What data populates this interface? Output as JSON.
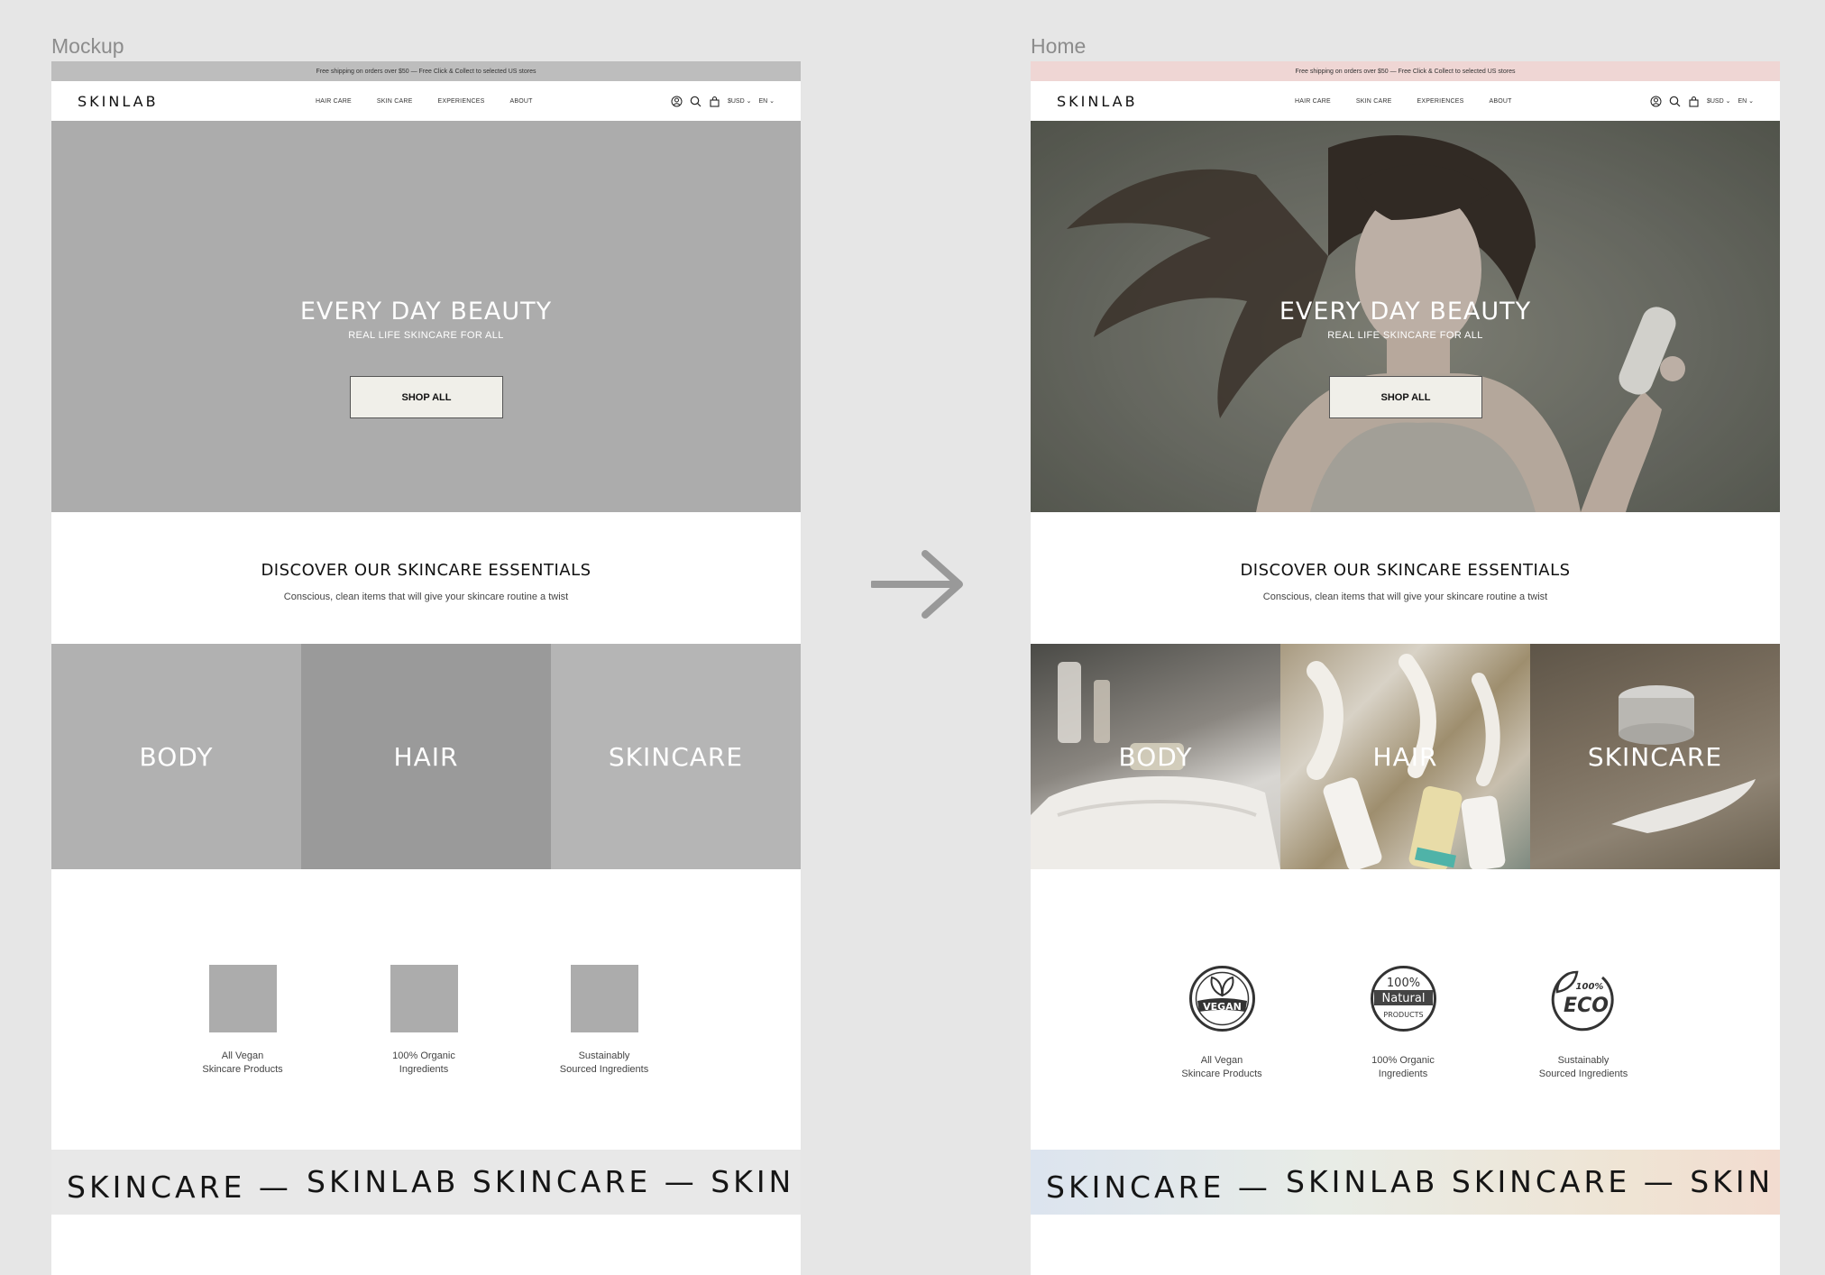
{
  "frames": {
    "mockup_label": "Mockup",
    "home_label": "Home"
  },
  "announcement": "Free shipping on orders over $50 — Free Click & Collect to selected US stores",
  "nav": {
    "logo": "SKINLAB",
    "items": [
      "HAIR CARE",
      "SKIN CARE",
      "EXPERIENCES",
      "ABOUT"
    ],
    "currency": "$USD",
    "language": "EN",
    "icons": [
      "account-icon",
      "search-icon",
      "cart-icon",
      "chevron-down-icon"
    ]
  },
  "hero": {
    "title": "EVERY DAY BEAUTY",
    "subtitle": "REAL LIFE SKINCARE FOR ALL",
    "button": "SHOP ALL"
  },
  "discover": {
    "title": "DISCOVER OUR SKINCARE ESSENTIALS",
    "subtitle": "Conscious, clean items that will give your skincare routine a twist"
  },
  "categories": [
    "BODY",
    "HAIR",
    "SKINCARE"
  ],
  "features": [
    {
      "line1": "All Vegan",
      "line2": "Skincare Products",
      "badge": "vegan-badge-icon",
      "badge_text": "VEGAN"
    },
    {
      "line1": "100% Organic",
      "line2": "Ingredients",
      "badge": "natural-badge-icon",
      "badge_text": [
        "100%",
        "Natural",
        "PRODUCTS"
      ]
    },
    {
      "line1": "Sustainably",
      "line2": "Sourced Ingredients",
      "badge": "eco-badge-icon",
      "badge_text": [
        "100%",
        "ECO"
      ]
    }
  ],
  "marquee": {
    "segment_1": "SKINCARE —",
    "segment_2": "SKINLAB SKINCARE — SKIN"
  },
  "colors": {
    "page_bg": "#e6e6e6",
    "mock_announce": "#bdbdbd",
    "home_announce": "#efd6d4",
    "mock_gray": "#acacac",
    "button_bg": "#f0efe9",
    "arrow": "#999999"
  }
}
